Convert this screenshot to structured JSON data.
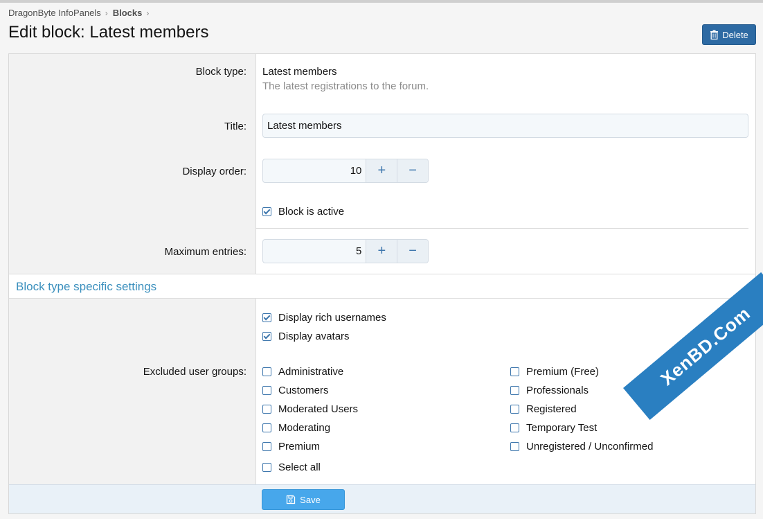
{
  "breadcrumb": {
    "items": [
      "DragonByte InfoPanels",
      "Blocks"
    ]
  },
  "page": {
    "title": "Edit block: Latest members"
  },
  "header": {
    "delete_label": "Delete"
  },
  "form": {
    "block_type": {
      "label": "Block type:",
      "value": "Latest members",
      "description": "The latest registrations to the forum."
    },
    "title": {
      "label": "Title:",
      "value": "Latest members"
    },
    "display_order": {
      "label": "Display order:",
      "value": "10"
    },
    "active": {
      "label": "Block is active",
      "checked": true
    },
    "max_entries": {
      "label": "Maximum entries:",
      "value": "5"
    }
  },
  "section": {
    "title": "Block type specific settings"
  },
  "options": {
    "rich_usernames": {
      "label": "Display rich usernames",
      "checked": true
    },
    "avatars": {
      "label": "Display avatars",
      "checked": true
    }
  },
  "excluded_groups": {
    "label": "Excluded user groups:",
    "left": [
      "Administrative",
      "Customers",
      "Moderated Users",
      "Moderating",
      "Premium"
    ],
    "right": [
      "Premium (Free)",
      "Professionals",
      "Registered",
      "Temporary Test",
      "Unregistered / Unconfirmed"
    ],
    "select_all": "Select all"
  },
  "footer": {
    "save_label": "Save"
  },
  "watermark": {
    "text": "XenBD.Com"
  },
  "colors": {
    "accent": "#2d6aa3",
    "section_title": "#3a8fbd",
    "save_button": "#47a7eb"
  },
  "icons": {
    "delete": "trash-icon",
    "save": "save-icon",
    "plus": "plus-icon",
    "minus": "minus-icon"
  }
}
